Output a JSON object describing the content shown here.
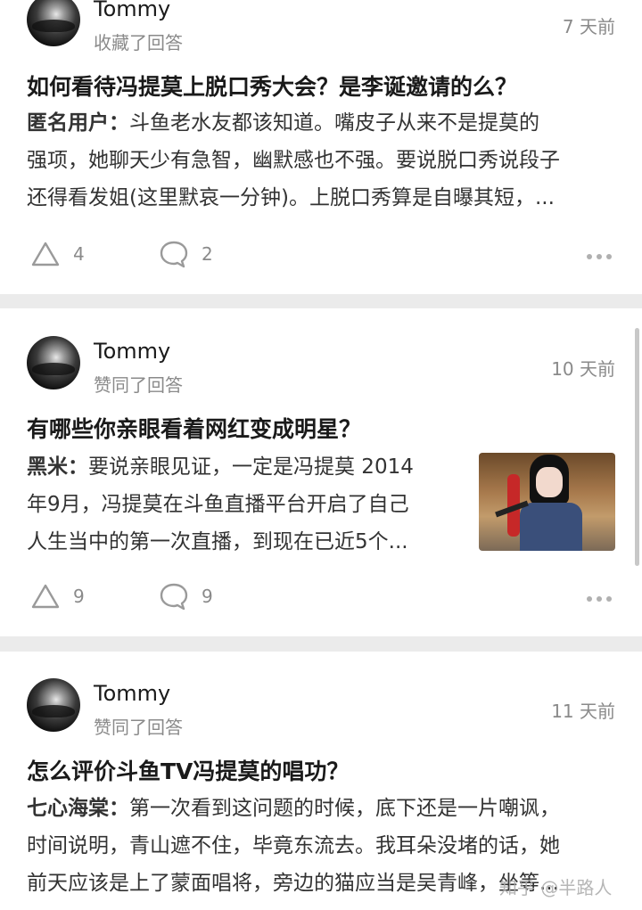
{
  "feed": [
    {
      "user": "Tommy",
      "action": "收藏了回答",
      "time": "7 天前",
      "question": "如何看待冯提莫上脱口秀大会？是李诞邀请的么？",
      "author": "匿名用户：",
      "lines": [
        "斗鱼老水友都该知道。嘴皮子从来不是提莫的",
        "强项，她聊天少有急智，幽默感也不强。要说脱口秀说段子",
        "还得看发姐(这里默哀一分钟)。上脱口秀算是自曝其短，..."
      ],
      "likes": "4",
      "comments": "2"
    },
    {
      "user": "Tommy",
      "action": "赞同了回答",
      "time": "10 天前",
      "question": "有哪些你亲眼看着网红变成明星？",
      "author": "黑米：",
      "lines": [
        "要说亲眼见证，一定是冯提莫 2014",
        "年9月，冯提莫在斗鱼直播平台开启了自己",
        "人生当中的第一次直播，到现在已近5个..."
      ],
      "likes": "9",
      "comments": "9",
      "thumbnail": "livestreamer-photo"
    },
    {
      "user": "Tommy",
      "action": "赞同了回答",
      "time": "11 天前",
      "question": "怎么评价斗鱼TV冯提莫的唱功？",
      "author": "七心海棠：",
      "lines": [
        "第一次看到这问题的时候，底下还是一片嘲讽，",
        "时间说明，青山遮不住，毕竟东流去。我耳朵没堵的话，她",
        "前天应该是上了蒙面唱将，旁边的猫应当是吴青峰，坐等..."
      ]
    }
  ],
  "watermark": "知乎 @半路人",
  "icons": {
    "like": "like-triangle-icon",
    "comment": "comment-bubble-icon",
    "more": "more-dots-icon"
  },
  "colors": {
    "card": "#ffffff",
    "separator": "#ebebeb",
    "meta_text": "#8a8a8a",
    "title_text": "#1a1a1a"
  }
}
